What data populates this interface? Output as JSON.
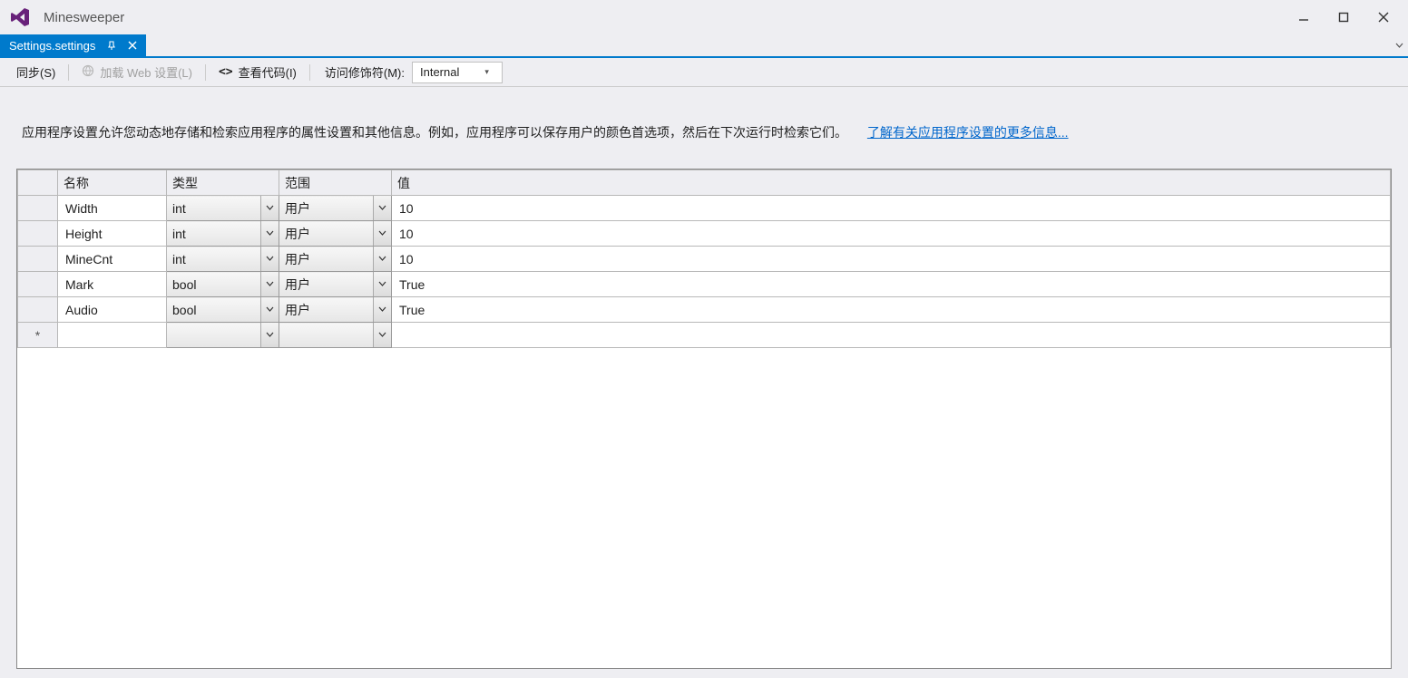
{
  "window": {
    "title": "Minesweeper"
  },
  "tab": {
    "label": "Settings.settings"
  },
  "toolbar": {
    "sync": "同步(S)",
    "load_web": "加载 Web 设置(L)",
    "view_code": "查看代码(I)",
    "access_label": "访问修饰符(M):",
    "access_value": "Internal"
  },
  "description": {
    "text": "应用程序设置允许您动态地存储和检索应用程序的属性设置和其他信息。例如，应用程序可以保存用户的颜色首选项，然后在下次运行时检索它们。",
    "link": "了解有关应用程序设置的更多信息..."
  },
  "grid": {
    "headers": {
      "name": "名称",
      "type": "类型",
      "scope": "范围",
      "value": "值"
    },
    "rows": [
      {
        "name": "Width",
        "type": "int",
        "scope": "用户",
        "value": "10"
      },
      {
        "name": "Height",
        "type": "int",
        "scope": "用户",
        "value": "10"
      },
      {
        "name": "MineCnt",
        "type": "int",
        "scope": "用户",
        "value": "10"
      },
      {
        "name": "Mark",
        "type": "bool",
        "scope": "用户",
        "value": "True"
      },
      {
        "name": "Audio",
        "type": "bool",
        "scope": "用户",
        "value": "True"
      }
    ],
    "new_row_marker": "*"
  }
}
